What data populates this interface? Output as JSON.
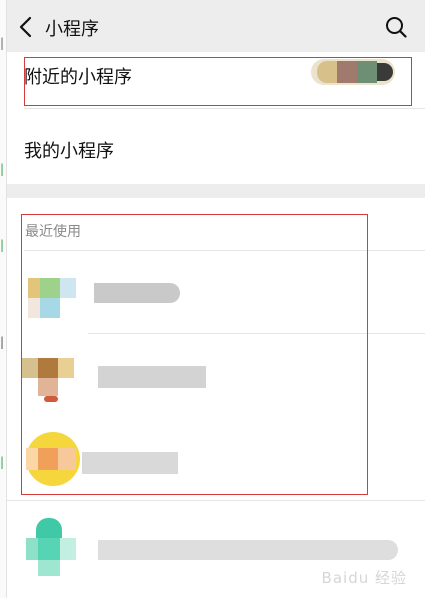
{
  "header": {
    "title": "小程序",
    "back_icon": "back-chevron-icon",
    "search_icon": "search-icon"
  },
  "items": {
    "nearby": "附近的小程序",
    "mine": "我的小程序"
  },
  "recent": {
    "label": "最近使用",
    "apps": [
      {
        "name": "",
        "icon": "app-icon-1"
      },
      {
        "name": "",
        "icon": "app-icon-2"
      },
      {
        "name": "",
        "icon": "app-icon-3"
      },
      {
        "name": "",
        "icon": "app-icon-4"
      }
    ]
  },
  "watermark": "Baidu 经验",
  "colors": {
    "background": "#ededed",
    "list_bg": "#ffffff",
    "highlight_border": "#d63a3a",
    "section_label": "#8a8a8a"
  }
}
